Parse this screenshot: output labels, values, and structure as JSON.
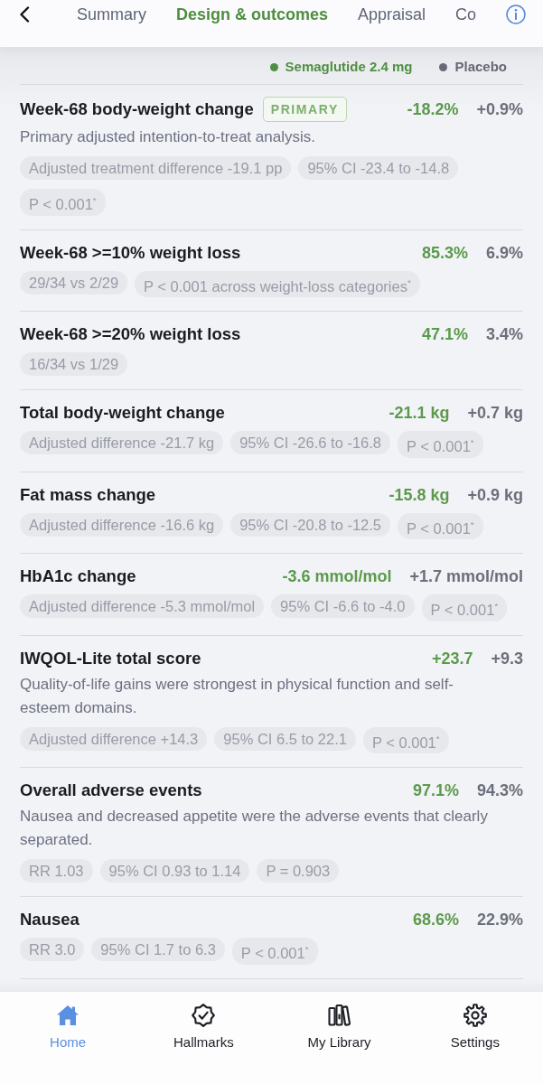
{
  "header": {
    "tabs": [
      {
        "label": "Summary",
        "selected": false
      },
      {
        "label": "Design & outcomes",
        "selected": true
      },
      {
        "label": "Appraisal",
        "selected": false
      },
      {
        "label": "Co",
        "selected": false
      }
    ]
  },
  "legend": [
    {
      "label": "Semaglutide 2.4 mg",
      "color": "#4f8f42"
    },
    {
      "label": "Placebo",
      "color": "#666a75"
    }
  ],
  "outcomes": [
    {
      "title": "Week-68 body-weight change",
      "badge": "PRIMARY",
      "treatment_value": "-18.2%",
      "placebo_value": "+0.9%",
      "note": "Primary adjusted intention-to-treat analysis.",
      "chips": [
        "Adjusted treatment difference -19.1 pp",
        "95% CI -23.4 to -14.8",
        "P < 0.001$^{*}$"
      ]
    },
    {
      "title": "Week-68 >=10% weight loss",
      "treatment_value": "85.3%",
      "placebo_value": "6.9%",
      "chips": [
        "29/34 vs 2/29",
        "P < 0.001 across weight-loss categories$^{*}$"
      ]
    },
    {
      "title": "Week-68 >=20% weight loss",
      "treatment_value": "47.1%",
      "placebo_value": "3.4%",
      "chips": [
        "16/34 vs 1/29"
      ]
    },
    {
      "title": "Total body-weight change",
      "treatment_value": "-21.1 kg",
      "placebo_value": "+0.7 kg",
      "chips": [
        "Adjusted difference -21.7 kg",
        "95% CI -26.6 to -16.8",
        "P < 0.001$^{*}$"
      ]
    },
    {
      "title": "Fat mass change",
      "treatment_value": "-15.8 kg",
      "placebo_value": "+0.9 kg",
      "chips": [
        "Adjusted difference -16.6 kg",
        "95% CI -20.8 to -12.5",
        "P < 0.001$^{*}$"
      ]
    },
    {
      "title": "HbA1c change",
      "treatment_value": "-3.6 mmol/mol",
      "placebo_value": "+1.7 mmol/mol",
      "chips": [
        "Adjusted difference -5.3 mmol/mol",
        "95% CI -6.6 to -4.0",
        "P < 0.001$^{*}$"
      ]
    },
    {
      "title": "IWQOL-Lite total score",
      "treatment_value": "+23.7",
      "placebo_value": "+9.3",
      "note": "Quality-of-life gains were strongest in physical function and self-esteem domains.",
      "chips": [
        "Adjusted difference +14.3",
        "95% CI 6.5 to 22.1",
        "P < 0.001$^{*}$"
      ]
    },
    {
      "title": "Overall adverse events",
      "treatment_value": "97.1%",
      "placebo_value": "94.3%",
      "note": "Nausea and decreased appetite were the adverse events that clearly separated.",
      "chips": [
        "RR 1.03",
        "95% CI 0.93 to 1.14",
        "P = 0.903"
      ]
    },
    {
      "title": "Nausea",
      "treatment_value": "68.6%",
      "placebo_value": "22.9%",
      "chips": [
        "RR 3.0",
        "95% CI 1.7 to 6.3",
        "P < 0.001$^{*}$"
      ]
    }
  ],
  "bottom_nav": [
    {
      "label": "Home",
      "selected": true
    },
    {
      "label": "Hallmarks",
      "selected": false
    },
    {
      "label": "My Library",
      "selected": false
    },
    {
      "label": "Settings",
      "selected": false
    }
  ]
}
